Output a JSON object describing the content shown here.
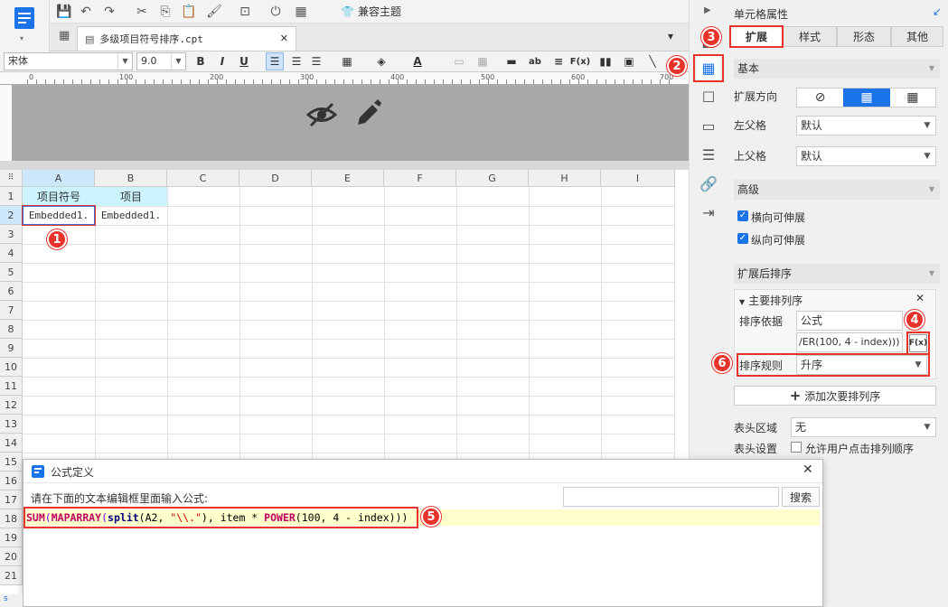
{
  "document": {
    "tab_name": "多级项目符号排序.cpt"
  },
  "toolbar": {
    "compat_theme": "兼容主题"
  },
  "format_bar": {
    "font_name": "宋体",
    "font_size": "9.0",
    "bold": "B",
    "italic": "I",
    "underline": "U",
    "ab": "ab",
    "fx": "F(x)"
  },
  "ruler": {
    "marks": [
      "0",
      "100",
      "200",
      "300",
      "400",
      "500",
      "600",
      "700"
    ]
  },
  "grid": {
    "columns": [
      "A",
      "B",
      "C",
      "D",
      "E",
      "F",
      "G",
      "H",
      "I"
    ],
    "rows": [
      "1",
      "2",
      "3",
      "4",
      "5",
      "6",
      "7",
      "8",
      "9",
      "10",
      "11",
      "12",
      "13",
      "14",
      "15",
      "16",
      "17",
      "18",
      "19",
      "20",
      "21"
    ],
    "cells": {
      "a1": "项目符号",
      "b1": "项目",
      "a2": "Embedded1.",
      "b2": "Embedded1."
    }
  },
  "badges": {
    "b1": "1",
    "b2": "2",
    "b3": "3",
    "b4": "4",
    "b5": "5",
    "b6": "6"
  },
  "panel": {
    "title": "单元格属性",
    "tabs": [
      "扩展",
      "样式",
      "形态",
      "其他"
    ],
    "basic": {
      "header": "基本",
      "expand_dir": "扩展方向",
      "left_parent": "左父格",
      "left_parent_value": "默认",
      "top_parent": "上父格",
      "top_parent_value": "默认"
    },
    "advanced": {
      "header": "高级",
      "h_expand": "横向可伸展",
      "v_expand": "纵向可伸展"
    },
    "sort": {
      "header": "扩展后排序",
      "primary": "主要排列序",
      "basis_label": "排序依据",
      "basis_value": "公式",
      "formula_value": "/ER(100, 4 - index)))",
      "rule_label": "排序规则",
      "rule_value": "升序",
      "add_secondary": "添加次要排列序"
    },
    "header_area_label": "表头区域",
    "header_area_value": "无",
    "header_setting_label": "表头设置",
    "header_setting_option": "允许用户点击排列顺序"
  },
  "dialog": {
    "title": "公式定义",
    "instruction": "请在下面的文本编辑框里面输入公式:",
    "search_button": "搜索",
    "search_placeholder": "",
    "formula": {
      "fn1": "SUM",
      "p1": "(",
      "fn2": "MAPARRAY",
      "p2": "(",
      "fn3": "split",
      "p3": "(A2, ",
      "str": "\"\\\\.\"",
      "p4": "), item * ",
      "fn4": "POWER",
      "p5": "(100, 4 - index)))"
    }
  },
  "bottom": {
    "tab_stub": "s"
  },
  "colors": {
    "accent": "#1a73e8",
    "badge": "#e8332b",
    "header_cell": "#ccf4ff",
    "formula_bg": "#ffffcc"
  }
}
